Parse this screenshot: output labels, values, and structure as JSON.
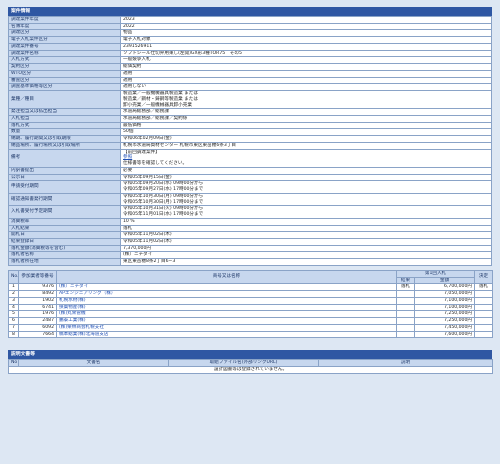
{
  "section_info": {
    "title": "案件情報",
    "rows": [
      {
        "label": "調達案件年度",
        "values": [
          "2023"
        ]
      },
      {
        "label": "名簿年度",
        "values": [
          "2022"
        ]
      },
      {
        "label": "調達区分",
        "values": [
          "物品"
        ]
      },
      {
        "label": "電子入札案件区分",
        "values": [
          "電子入札対象"
        ]
      },
      {
        "label": "調達案件番号",
        "values": [
          "2391526911"
        ]
      },
      {
        "label": "調達案件名称",
        "values": [
          "ソフトシール仕切弁用束し(左開)GX形3種TOR75　その5"
        ]
      },
      {
        "label": "入札方式",
        "values": [
          "一般競争入札"
        ]
      },
      {
        "label": "契約区分",
        "values": [
          "総価契約"
        ]
      },
      {
        "label": "WTO区分",
        "values": [
          "適用"
        ]
      },
      {
        "label": "審査区分",
        "values": [
          "適用"
        ]
      },
      {
        "label": "調査基準価格等区分",
        "values": [
          "適用しない"
        ]
      },
      {
        "label": "業種／種目",
        "values": [
          "製造業／一般機械器具製造業 または",
          "製造業／鋼材・鋳鋼等製造業 または",
          "卸小売業／一般機械器具卸小売業"
        ]
      },
      {
        "label": "発注担当又は払出担当",
        "values": [
          "水道局総務部／総務課"
        ]
      },
      {
        "label": "入札担当",
        "values": [
          "水道局総務部／総務課／契約係"
        ]
      },
      {
        "label": "落札方式",
        "values": [
          "最低価格"
        ]
      },
      {
        "label": "数量",
        "values": [
          "50個"
        ]
      },
      {
        "label": "納期、履行期間又は引取期限",
        "values": [
          "令和06年02月09日(金)"
        ]
      },
      {
        "label": "納品場所、履行場所又は引取場所",
        "values": [
          "札幌市水道局資材センター 札幌市東区東苗穂6条3丁目"
        ]
      },
      {
        "label": "備考",
        "values": [
          "【前回調達案件】",
          "仕様書等を確認してください。"
        ],
        "link": "参照"
      },
      {
        "label": "内訳書提出",
        "values": [
          "必要"
        ]
      },
      {
        "label": "公示日",
        "values": [
          "令和05年09月15日(金)"
        ]
      },
      {
        "label": "申請受付期間",
        "values": [
          "令和05年09月20日(水) 09時00分から",
          "令和05年09月27日(水) 17時00分まで"
        ]
      },
      {
        "label": "確認通知書発行期間",
        "values": [
          "令和05年10月30日(月) 09時00分から",
          "令和05年10月30日(月) 17時00分まで"
        ]
      },
      {
        "label": "入札書受付予定期間",
        "values": [
          "令和05年10月31日(火) 09時00分から",
          "令和05年11月01日(水) 17時00分まで"
        ]
      },
      {
        "label": "消費税率",
        "values": [
          "10 %"
        ]
      },
      {
        "label": "入札結果",
        "values": [
          "落札"
        ]
      },
      {
        "label": "開札日",
        "values": [
          "令和05年11月02日(木)"
        ]
      },
      {
        "label": "結果登録日",
        "values": [
          "令和05年11月02日(木)"
        ]
      },
      {
        "label": "落札金額(消費税等を含む)",
        "values": [
          "7,370,000円"
        ]
      },
      {
        "label": "落札者名称",
        "values": [
          "(株）ニチダイ"
        ]
      },
      {
        "label": "落札者所在地",
        "values": [
          "東区東苗穂8条2丁目6−3"
        ]
      }
    ]
  },
  "results": {
    "headers": {
      "no": "No.",
      "code": "参加業者等番号",
      "name": "商号又は名称",
      "round": "第1回入札",
      "result": "結果",
      "amount": "金額",
      "decision": "決定"
    },
    "rows": [
      {
        "no": "1",
        "code": "9376",
        "name": "(株）ニチダイ",
        "result": "落札",
        "amount": "6,700,000円",
        "decision": "落札"
      },
      {
        "no": "2",
        "code": "8492",
        "name": "APエンジニアリング（株）",
        "result": "",
        "amount": "7,050,000円",
        "decision": ""
      },
      {
        "no": "3",
        "code": "1902",
        "name": "札幌水材(株)",
        "result": "",
        "amount": "7,100,000円",
        "decision": ""
      },
      {
        "no": "4",
        "code": "6741",
        "name": "扶桑物産(株)",
        "result": "",
        "amount": "7,100,000円",
        "decision": ""
      },
      {
        "no": "5",
        "code": "1976",
        "name": "(株)丸栄管機",
        "result": "",
        "amount": "7,250,000円",
        "decision": ""
      },
      {
        "no": "6",
        "code": "2487",
        "name": "鵬泰工業(株)",
        "result": "",
        "amount": "7,250,000円",
        "decision": ""
      },
      {
        "no": "7",
        "code": "6092",
        "name": "(株)栗林商会札幌支社",
        "result": "",
        "amount": "7,450,000円",
        "decision": ""
      },
      {
        "no": "8",
        "code": "7664",
        "name": "橋本総業(株)北海道支店",
        "result": "",
        "amount": "7,600,000円",
        "decision": ""
      }
    ]
  },
  "attachments": {
    "title": "説明文書等",
    "headers": {
      "no": "No",
      "doc": "文書名",
      "file": "取組ファイル名(外部リンクURL)",
      "desc": "説明"
    },
    "empty_message": "設計図書等は登録されていません。"
  }
}
